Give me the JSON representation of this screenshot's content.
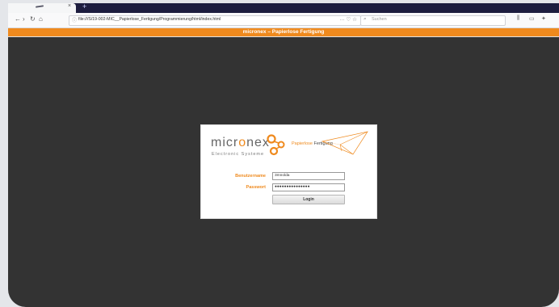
{
  "browser": {
    "tab_title": "",
    "tab_close": "×",
    "new_tab": "+",
    "url": "file:///S/19-002-MIC__Papierlose_Fertigung/Programmierung/html/index.html",
    "url_actions": "··· ♡ ☆",
    "search_placeholder": "Suchen",
    "icons": [
      "back-icon",
      "forward-icon",
      "reload-icon",
      "home-icon",
      "info-icon",
      "search-icon",
      "library-icon",
      "sidebar-icon",
      "extension-icon"
    ]
  },
  "app": {
    "title": "micronex – Papierlose Fertigung"
  },
  "login": {
    "logo_part1": "micr",
    "logo_part2": "o",
    "logo_part3": "nex",
    "logo_sub": "Electronic Systeme",
    "tagline_word1": "Papierlose",
    "tagline_word2": " Fertigung",
    "username_label": "Benutzername",
    "username_value": "3mnolda",
    "password_label": "Passwort",
    "password_value": "●●●●●●●●●●●●●●●",
    "login_button": "Login"
  },
  "colors": {
    "accent": "#ef8a1e",
    "background": "#333333",
    "tabstrip": "#1d1d3f"
  }
}
